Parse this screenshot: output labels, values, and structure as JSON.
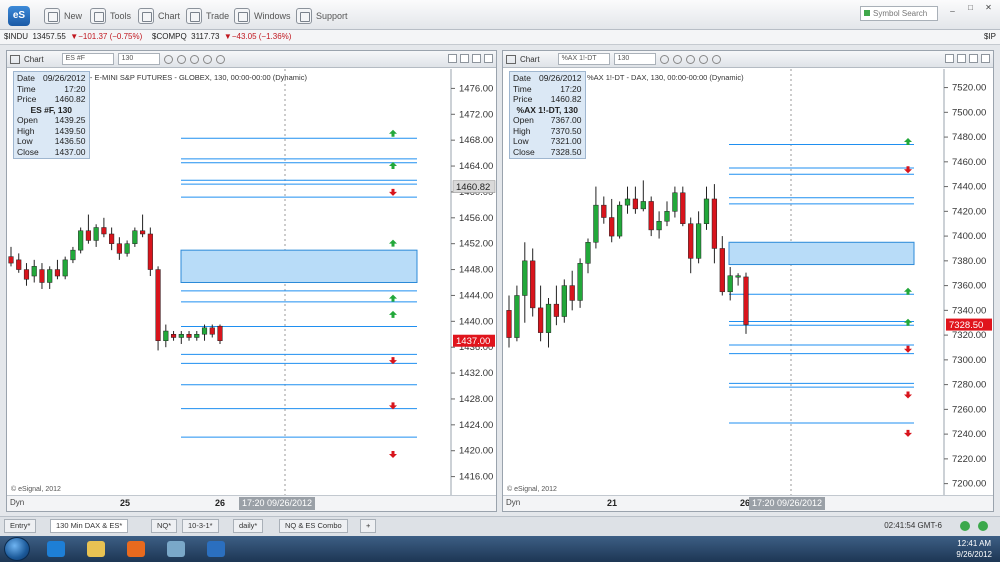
{
  "app": {
    "logo_text": "eS",
    "toolbar": [
      {
        "name": "new",
        "label": "New",
        "icon": "document-icon"
      },
      {
        "name": "tools",
        "label": "Tools",
        "icon": "tools-icon"
      },
      {
        "name": "chart",
        "label": "Chart",
        "icon": "chart-icon"
      },
      {
        "name": "trade",
        "label": "Trade",
        "icon": "trade-icon"
      },
      {
        "name": "windows",
        "label": "Windows",
        "icon": "windows-icon"
      },
      {
        "name": "support",
        "label": "Support",
        "icon": "help-icon"
      }
    ],
    "symbol_search_placeholder": "Symbol Search",
    "win_controls": [
      "_",
      "□",
      "✕"
    ]
  },
  "ticker": [
    {
      "sym": "$INDU",
      "last": "13457.55",
      "chg": "▼−101.37 (−0.75%)"
    },
    {
      "sym": "$COMPQ",
      "last": "3117.73",
      "chg": "▼−43.05 (−1.36%)"
    },
    {
      "sym": "$IP",
      "last": "",
      "chg": ""
    }
  ],
  "colors": {
    "up": "#22a83a",
    "down": "#d8141c",
    "level_line": "#1f8ff0",
    "zone_fill": "#b8dcf8",
    "zone_stroke": "#2b8ad8"
  },
  "charts": [
    {
      "header": {
        "label": "Chart",
        "symbol": "ES #F",
        "interval": "130"
      },
      "title": "ES #F - E-MINI S&P FUTURES - GLOBEX, 130, 00:00-00:00 (Dynamic)",
      "data_box": {
        "date_label": "Date",
        "date": "09/26/2012",
        "time_label": "Time",
        "time": "17:20",
        "price_label": "Price",
        "price": "1460.82",
        "sym_line": "ES #F, 130",
        "open_label": "Open",
        "open": "1439.25",
        "high_label": "High",
        "high": "1439.50",
        "low_label": "Low",
        "low": "1436.50",
        "close_label": "Close",
        "close": "1437.00"
      },
      "copyright": "© eSignal, 2012",
      "footer": {
        "dyn": "Dyn",
        "date_labels": [
          "25",
          "26"
        ],
        "cursor": "17:20 09/26/2012"
      },
      "chart_data": {
        "type": "candlestick",
        "ylim": [
          1413,
          1479
        ],
        "y_ticks": [
          "1476.00",
          "1472.00",
          "1468.00",
          "1464.00",
          "1460.00",
          "1456.00",
          "1452.00",
          "1448.00",
          "1444.00",
          "1440.00",
          "1436.00",
          "1432.00",
          "1428.00",
          "1424.00",
          "1420.00",
          "1416.00"
        ],
        "last_price": "1437.00",
        "cursor_price": "1460.82",
        "candles": [
          {
            "o": 1450.0,
            "h": 1451.5,
            "l": 1448.5,
            "c": 1449.0
          },
          {
            "o": 1449.5,
            "h": 1450.5,
            "l": 1447.5,
            "c": 1448.0
          },
          {
            "o": 1448.0,
            "h": 1449.0,
            "l": 1445.5,
            "c": 1446.5
          },
          {
            "o": 1447.0,
            "h": 1449.5,
            "l": 1446.0,
            "c": 1448.5
          },
          {
            "o": 1448.0,
            "h": 1449.0,
            "l": 1445.0,
            "c": 1446.0
          },
          {
            "o": 1446.0,
            "h": 1448.5,
            "l": 1445.0,
            "c": 1448.0
          },
          {
            "o": 1448.0,
            "h": 1449.5,
            "l": 1446.5,
            "c": 1447.0
          },
          {
            "o": 1447.0,
            "h": 1450.0,
            "l": 1446.5,
            "c": 1449.5
          },
          {
            "o": 1449.5,
            "h": 1451.5,
            "l": 1449.0,
            "c": 1451.0
          },
          {
            "o": 1451.0,
            "h": 1454.5,
            "l": 1450.5,
            "c": 1454.0
          },
          {
            "o": 1454.0,
            "h": 1456.5,
            "l": 1452.0,
            "c": 1452.5
          },
          {
            "o": 1452.5,
            "h": 1455.0,
            "l": 1451.5,
            "c": 1454.5
          },
          {
            "o": 1454.5,
            "h": 1456.0,
            "l": 1453.0,
            "c": 1453.5
          },
          {
            "o": 1453.5,
            "h": 1454.5,
            "l": 1451.0,
            "c": 1452.0
          },
          {
            "o": 1452.0,
            "h": 1453.0,
            "l": 1449.5,
            "c": 1450.5
          },
          {
            "o": 1450.5,
            "h": 1452.5,
            "l": 1450.0,
            "c": 1452.0
          },
          {
            "o": 1452.0,
            "h": 1454.5,
            "l": 1451.5,
            "c": 1454.0
          },
          {
            "o": 1454.0,
            "h": 1456.5,
            "l": 1453.0,
            "c": 1453.5
          },
          {
            "o": 1453.5,
            "h": 1454.5,
            "l": 1447.0,
            "c": 1448.0
          },
          {
            "o": 1448.0,
            "h": 1448.5,
            "l": 1435.5,
            "c": 1437.0
          },
          {
            "o": 1437.0,
            "h": 1439.5,
            "l": 1436.0,
            "c": 1438.5
          },
          {
            "o": 1438.0,
            "h": 1438.5,
            "l": 1437.0,
            "c": 1437.5
          },
          {
            "o": 1437.5,
            "h": 1438.5,
            "l": 1436.5,
            "c": 1438.0
          },
          {
            "o": 1438.0,
            "h": 1438.5,
            "l": 1437.0,
            "c": 1437.5
          },
          {
            "o": 1437.5,
            "h": 1438.5,
            "l": 1437.0,
            "c": 1438.0
          },
          {
            "o": 1438.0,
            "h": 1439.5,
            "l": 1437.0,
            "c": 1439.0
          },
          {
            "o": 1439.0,
            "h": 1439.5,
            "l": 1437.5,
            "c": 1438.0
          },
          {
            "o": 1439.25,
            "h": 1439.5,
            "l": 1436.5,
            "c": 1437.0
          }
        ],
        "levels": [
          1468.3,
          1465.1,
          1464.5,
          1461.8,
          1461.2,
          1459.2,
          1444.7,
          1443.0,
          1439.2,
          1434.9,
          1433.5,
          1430.2,
          1426.5,
          1422.1
        ],
        "zone": [
          1446.0,
          1451.0
        ],
        "arrows": [
          {
            "y": 1469.0,
            "dir": "up"
          },
          {
            "y": 1464.0,
            "dir": "up"
          },
          {
            "y": 1460.0,
            "dir": "down"
          },
          {
            "y": 1452.0,
            "dir": "up"
          },
          {
            "y": 1443.5,
            "dir": "up"
          },
          {
            "y": 1441.0,
            "dir": "up"
          },
          {
            "y": 1434.0,
            "dir": "down"
          },
          {
            "y": 1427.0,
            "dir": "down"
          },
          {
            "y": 1419.5,
            "dir": "down"
          }
        ]
      }
    },
    {
      "header": {
        "label": "Chart",
        "symbol": "%AX 1!-DT",
        "interval": "130"
      },
      "title": "%AX 1!-DT - DAX, 130, 00:00-00:00 (Dynamic)",
      "data_box": {
        "date_label": "Date",
        "date": "09/26/2012",
        "time_label": "Time",
        "time": "17:20",
        "price_label": "Price",
        "price": "1460.82",
        "sym_line": "%AX 1!-DT, 130",
        "open_label": "Open",
        "open": "7367.00",
        "high_label": "High",
        "high": "7370.50",
        "low_label": "Low",
        "low": "7321.00",
        "close_label": "Close",
        "close": "7328.50"
      },
      "copyright": "© eSignal, 2012",
      "footer": {
        "dyn": "Dyn",
        "date_labels": [
          "21",
          "26"
        ],
        "cursor": "17:20 09/26/2012"
      },
      "chart_data": {
        "type": "candlestick",
        "ylim": [
          7190,
          7535
        ],
        "y_ticks": [
          "7520.00",
          "7500.00",
          "7480.00",
          "7460.00",
          "7440.00",
          "7420.00",
          "7400.00",
          "7380.00",
          "7360.00",
          "7340.00",
          "7320.00",
          "7300.00",
          "7280.00",
          "7260.00",
          "7240.00",
          "7220.00",
          "7200.00"
        ],
        "last_price": "7328.50",
        "candles": [
          {
            "o": 7340,
            "h": 7352,
            "l": 7310,
            "c": 7318
          },
          {
            "o": 7318,
            "h": 7360,
            "l": 7315,
            "c": 7352
          },
          {
            "o": 7352,
            "h": 7395,
            "l": 7330,
            "c": 7380
          },
          {
            "o": 7380,
            "h": 7390,
            "l": 7335,
            "c": 7342
          },
          {
            "o": 7342,
            "h": 7360,
            "l": 7315,
            "c": 7322
          },
          {
            "o": 7322,
            "h": 7350,
            "l": 7310,
            "c": 7345
          },
          {
            "o": 7345,
            "h": 7360,
            "l": 7328,
            "c": 7335
          },
          {
            "o": 7335,
            "h": 7365,
            "l": 7330,
            "c": 7360
          },
          {
            "o": 7360,
            "h": 7372,
            "l": 7340,
            "c": 7348
          },
          {
            "o": 7348,
            "h": 7382,
            "l": 7342,
            "c": 7378
          },
          {
            "o": 7378,
            "h": 7398,
            "l": 7370,
            "c": 7395
          },
          {
            "o": 7395,
            "h": 7440,
            "l": 7390,
            "c": 7425
          },
          {
            "o": 7425,
            "h": 7432,
            "l": 7410,
            "c": 7415
          },
          {
            "o": 7415,
            "h": 7430,
            "l": 7395,
            "c": 7400
          },
          {
            "o": 7400,
            "h": 7428,
            "l": 7398,
            "c": 7425
          },
          {
            "o": 7425,
            "h": 7440,
            "l": 7418,
            "c": 7430
          },
          {
            "o": 7430,
            "h": 7440,
            "l": 7418,
            "c": 7422
          },
          {
            "o": 7422,
            "h": 7445,
            "l": 7420,
            "c": 7428
          },
          {
            "o": 7428,
            "h": 7432,
            "l": 7400,
            "c": 7405
          },
          {
            "o": 7405,
            "h": 7420,
            "l": 7398,
            "c": 7412
          },
          {
            "o": 7412,
            "h": 7428,
            "l": 7408,
            "c": 7420
          },
          {
            "o": 7420,
            "h": 7440,
            "l": 7415,
            "c": 7435
          },
          {
            "o": 7435,
            "h": 7440,
            "l": 7408,
            "c": 7410
          },
          {
            "o": 7410,
            "h": 7415,
            "l": 7370,
            "c": 7382
          },
          {
            "o": 7382,
            "h": 7420,
            "l": 7378,
            "c": 7410
          },
          {
            "o": 7410,
            "h": 7440,
            "l": 7405,
            "c": 7430
          },
          {
            "o": 7430,
            "h": 7442,
            "l": 7378,
            "c": 7390
          },
          {
            "o": 7390,
            "h": 7400,
            "l": 7352,
            "c": 7355
          },
          {
            "o": 7355,
            "h": 7375,
            "l": 7348,
            "c": 7368
          },
          {
            "o": 7367,
            "h": 7370,
            "l": 7360,
            "c": 7368
          },
          {
            "o": 7367,
            "h": 7370.5,
            "l": 7321,
            "c": 7328.5
          }
        ],
        "levels": [
          7474,
          7455,
          7450,
          7431,
          7426,
          7353,
          7331,
          7328,
          7312,
          7305,
          7281,
          7278,
          7249
        ],
        "zone": [
          7377,
          7395
        ],
        "arrows": [
          {
            "y": 7476,
            "dir": "up"
          },
          {
            "y": 7454,
            "dir": "down"
          },
          {
            "y": 7355,
            "dir": "up"
          },
          {
            "y": 7330,
            "dir": "up"
          },
          {
            "y": 7309,
            "dir": "down"
          },
          {
            "y": 7272,
            "dir": "down"
          },
          {
            "y": 7241,
            "dir": "down"
          }
        ]
      }
    }
  ],
  "tabs": [
    {
      "label": "Entry*",
      "active": false
    },
    {
      "label": "130 Min DAX & ES*",
      "active": true
    },
    {
      "label": "NQ*",
      "active": false
    },
    {
      "label": "10-3-1*",
      "active": false
    },
    {
      "label": "daily*",
      "active": false
    },
    {
      "label": "NQ & ES Combo",
      "active": false
    },
    {
      "label": "+",
      "active": false
    }
  ],
  "status": {
    "time": "02:41:54 GMT-6"
  },
  "taskbar": {
    "clock_time": "12:41 AM",
    "clock_date": "9/26/2012",
    "apps": [
      {
        "name": "internet-explorer-icon",
        "color": "#1e7fd6"
      },
      {
        "name": "folder-icon",
        "color": "#e8c253"
      },
      {
        "name": "media-player-icon",
        "color": "#e86a1e"
      },
      {
        "name": "monitor-app-icon",
        "color": "#7aa8c9"
      },
      {
        "name": "esignal-app-icon",
        "color": "#2b6fbf"
      }
    ]
  }
}
